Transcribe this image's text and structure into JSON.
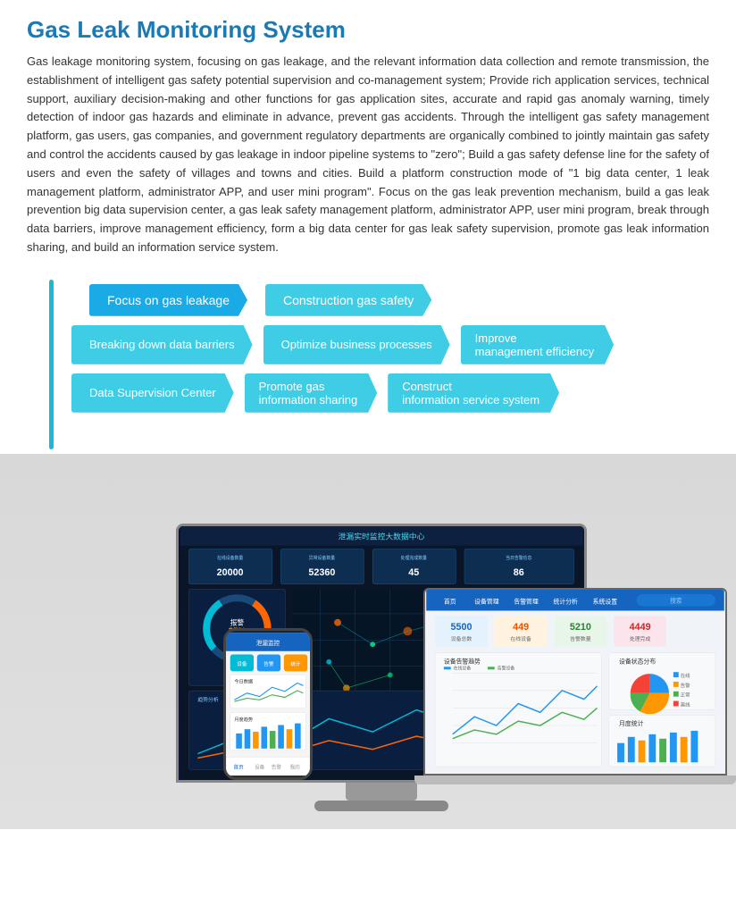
{
  "page": {
    "title": "Gas Leak Monitoring System",
    "description": "Gas leakage monitoring system, focusing on gas leakage, and the relevant information data collection and remote transmission, the establishment of intelligent gas safety potential supervision and co-management system; Provide rich application services, technical support, auxiliary decision-making and other functions for gas application sites, accurate and rapid gas anomaly warning, timely detection of indoor gas hazards and eliminate in advance, prevent gas accidents. Through the intelligent gas safety management platform, gas users, gas companies, and government regulatory departments are organically combined to jointly maintain gas safety and control the accidents caused by gas leakage in indoor pipeline systems to \"zero\"; Build a gas safety defense line for the safety of users and even the safety of villages and towns and cities. Build a platform construction mode of \"1 big data center, 1 leak management platform, administrator APP, and user mini program\". Focus on the gas leak prevention mechanism, build a gas leak prevention big data supervision center, a gas leak safety management platform, administrator APP, user mini program, break through data barriers, improve management efficiency, form a big data center for gas leak safety supervision, promote gas leak information sharing, and build an information service system."
  },
  "features": {
    "row1": [
      {
        "label": "Focus on gas leakage",
        "style": "dark"
      },
      {
        "label": "Construction gas safety",
        "style": "light"
      }
    ],
    "row2": [
      {
        "label": "Breaking down data barriers",
        "style": "light"
      },
      {
        "label": "Optimize business processes",
        "style": "light"
      },
      {
        "label_line1": "Improve",
        "label_line2": "management efficiency",
        "style": "light"
      }
    ],
    "row3": [
      {
        "label": "Data Supervision Center",
        "style": "light"
      },
      {
        "label_line1": "Promote gas",
        "label_line2": "information sharing",
        "style": "light"
      },
      {
        "label_line1": "Construct",
        "label_line2": "information service system",
        "style": "light"
      }
    ]
  },
  "monitor": {
    "title": "泄漏实时监控大数据中心",
    "stats": [
      {
        "label": "在线设备数量",
        "value": "20000"
      },
      {
        "label": "异常设备数量",
        "value": "52360"
      },
      {
        "label": "处理完成数量",
        "value": "45"
      },
      {
        "label": "当日告警信息",
        "value": "86"
      }
    ]
  },
  "laptop": {
    "nav_items": [
      "首页",
      "设备管理",
      "告警管理",
      "统计分析",
      "系统设置"
    ],
    "stats": [
      {
        "label": "设备总数",
        "value": "5500"
      },
      {
        "label": "在线设备",
        "value": "449"
      },
      {
        "label": "告警数量",
        "value": "5210"
      },
      {
        "label": "处理完成",
        "value": "4449"
      }
    ]
  },
  "colors": {
    "primary": "#1aabe6",
    "secondary": "#3fcde6",
    "accent": "#00bcd4",
    "title": "#1a7ab5",
    "text": "#333333"
  }
}
